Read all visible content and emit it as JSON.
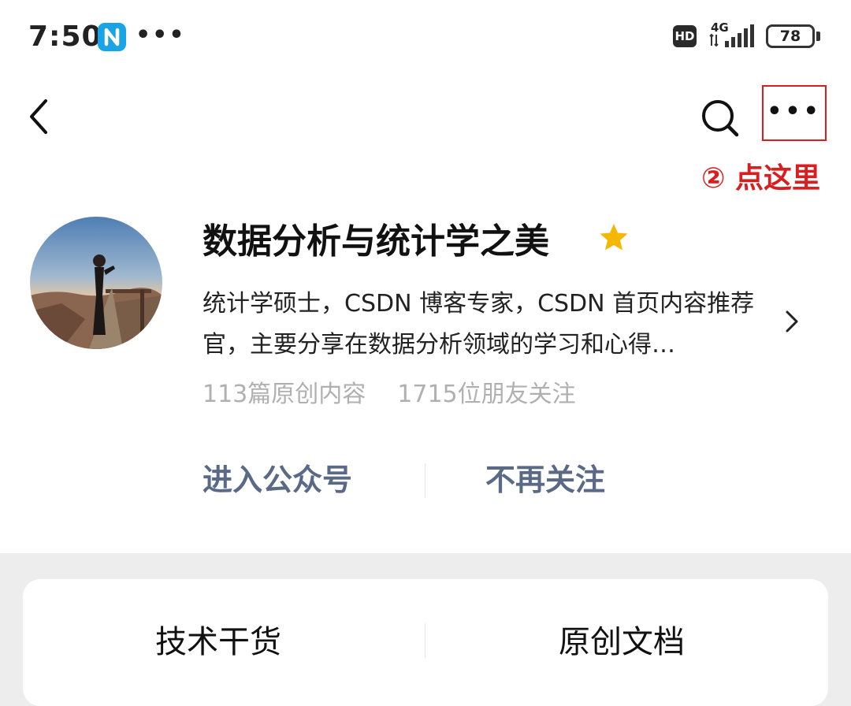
{
  "status_bar": {
    "time": "7:50",
    "app_badge_icon": "n-app-icon",
    "overflow": "•••",
    "hd": "HD",
    "network": "4G",
    "battery": "78"
  },
  "nav": {
    "back_icon": "chevron-left-icon",
    "search_icon": "search-icon",
    "more_label": "•••",
    "annotation": "② 点这里"
  },
  "profile": {
    "name": "数据分析与统计学之美",
    "bio": "统计学硕士，CSDN 博客专家，CSDN 首页内容推荐官，主要分享在数据分析领域的学习和心得…",
    "articles": "113篇原创内容",
    "followers": "1715位朋友关注"
  },
  "actions": {
    "enter": "进入公众号",
    "unfollow": "不再关注"
  },
  "menu": {
    "items": [
      "技术干货",
      "原创文档"
    ]
  },
  "colors": {
    "annotation_red": "#d81e1e",
    "action_blue_gray": "#5a6a86",
    "star_gold": "#f5b800",
    "section_gray": "#ededed"
  }
}
